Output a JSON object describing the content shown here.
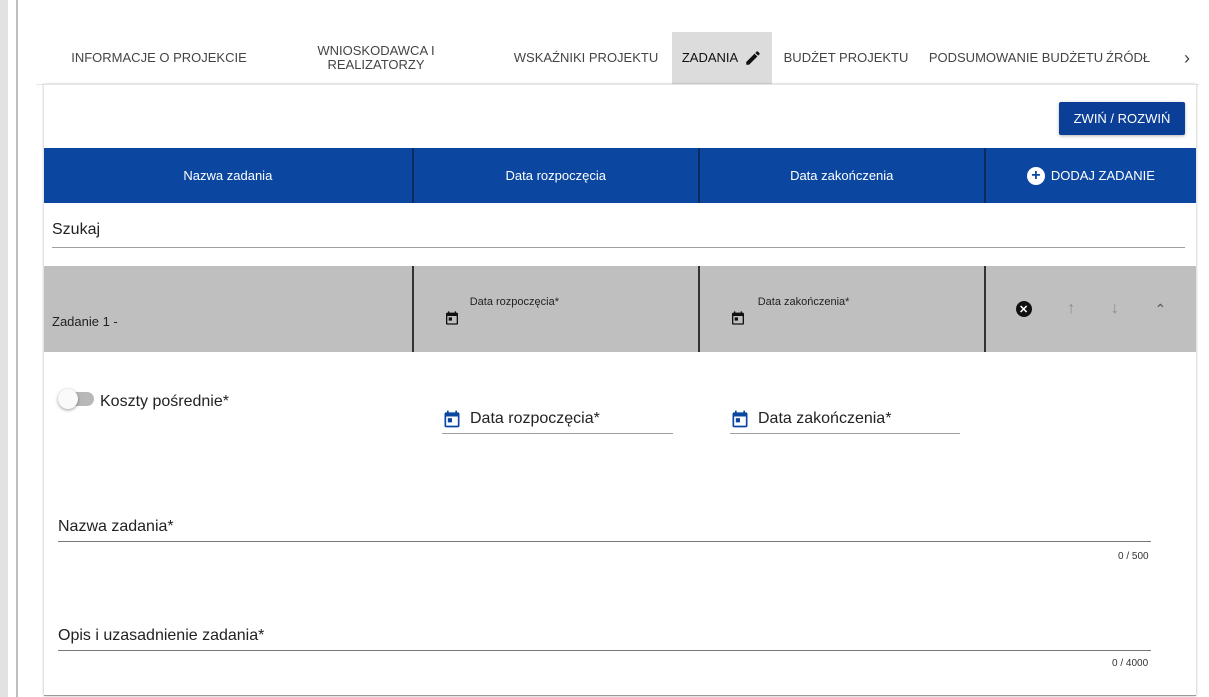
{
  "tabs": [
    {
      "label": "INFORMACJE O PROJEKCIE"
    },
    {
      "label": "WNIOSKODAWCA I REALIZATORZY"
    },
    {
      "label": "WSKAŹNIKI PROJEKTU"
    },
    {
      "label": "ZADANIA"
    },
    {
      "label": "BUDŻET PROJEKTU"
    },
    {
      "label": "PODSUMOWANIE BUDŻETU"
    },
    {
      "label": "ŹRÓDŁ"
    }
  ],
  "collapse_button": "ZWIŃ / ROZWIŃ",
  "table_header": {
    "name": "Nazwa zadania",
    "start": "Data rozpoczęcia",
    "end": "Data zakończenia",
    "add": "DODAJ ZADANIE"
  },
  "search": {
    "placeholder": "Szukaj"
  },
  "task": {
    "name": "Zadanie 1 -",
    "start_label": "Data rozpoczęcia*",
    "end_label": "Data zakończenia*"
  },
  "form": {
    "indirect_costs": "Koszty pośrednie*",
    "start_label": "Data rozpoczęcia*",
    "end_label": "Data zakończenia*",
    "name_label": "Nazwa zadania*",
    "name_counter": "0 / 500",
    "desc_label": "Opis i uzasadnienie zadania*",
    "desc_counter": "0 / 4000"
  },
  "colors": {
    "primary": "#0b47a1",
    "button": "#0b3e96",
    "row": "#bfbfbf"
  },
  "icons": [
    "pencil-icon",
    "plus-circle-icon",
    "calendar-icon",
    "close-circle-icon",
    "arrow-up-icon",
    "arrow-down-icon",
    "chevron-up-icon",
    "chevron-right-icon"
  ]
}
